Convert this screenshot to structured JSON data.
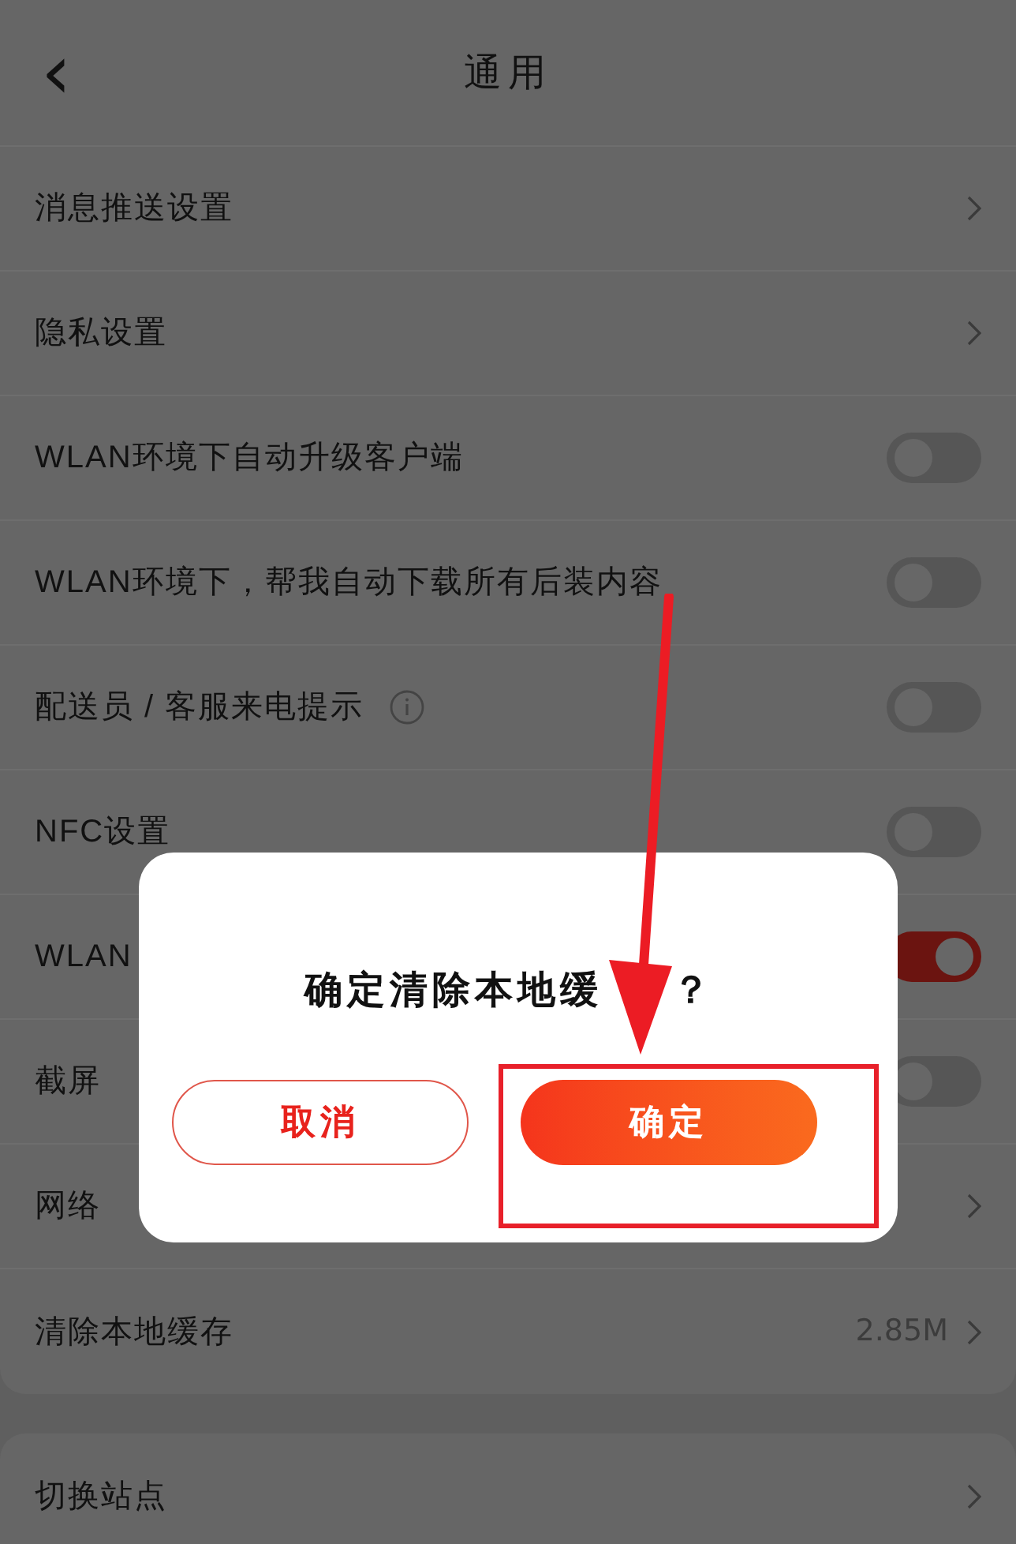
{
  "header": {
    "back": "‹",
    "title": "通用"
  },
  "rows": [
    {
      "kind": "link",
      "label": "消息推送设置",
      "info": false
    },
    {
      "kind": "link",
      "label": "隐私设置",
      "info": false
    },
    {
      "kind": "toggle",
      "label": "WLAN环境下自动升级客户端",
      "on": false,
      "info": false
    },
    {
      "kind": "toggle",
      "label": "WLAN环境下，帮我自动下载所有后装内容",
      "on": false,
      "info": false
    },
    {
      "kind": "toggle",
      "label": "配送员 / 客服来电提示",
      "on": false,
      "info": true
    },
    {
      "kind": "toggle",
      "label": "NFC设置",
      "on": false,
      "info": false
    },
    {
      "kind": "toggle",
      "label": "WLAN",
      "on": true,
      "info": false
    },
    {
      "kind": "toggle",
      "label": "截屏",
      "on": false,
      "info": false
    },
    {
      "kind": "link",
      "label": "网络",
      "info": false
    },
    {
      "kind": "link",
      "label": "清除本地缓存",
      "value": "2.85M",
      "info": false
    }
  ],
  "bottom_rows": [
    {
      "kind": "link",
      "label": "切换站点"
    }
  ],
  "dialog": {
    "message": "确定清除本地缓",
    "message_end": "？",
    "buttons": [
      {
        "kind": "secondary",
        "label": "取消"
      },
      {
        "kind": "primary",
        "label": "确定"
      }
    ]
  }
}
